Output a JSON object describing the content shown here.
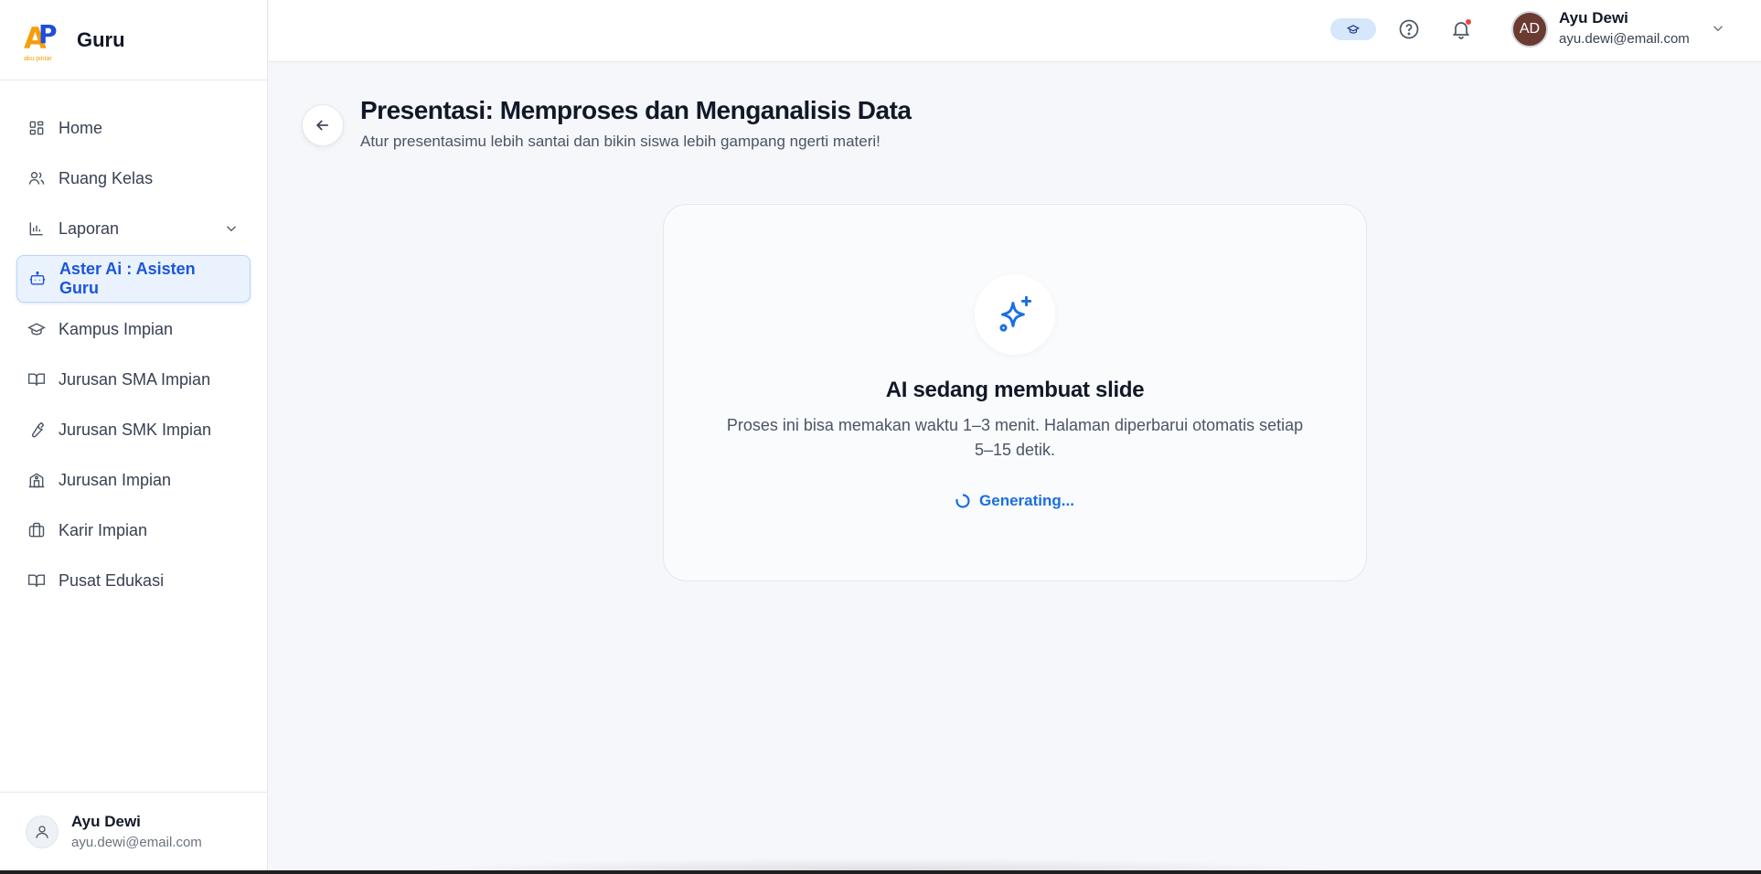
{
  "brand": {
    "logo_text": "AP",
    "logo_sub": "aku pintar",
    "name": "Guru"
  },
  "sidebar": {
    "items": [
      {
        "label": "Home",
        "icon": "home-grid-icon"
      },
      {
        "label": "Ruang Kelas",
        "icon": "users-icon"
      },
      {
        "label": "Laporan",
        "icon": "bar-chart-icon"
      },
      {
        "label": "Aster Ai : Asisten Guru",
        "icon": "robot-icon"
      },
      {
        "label": "Kampus Impian",
        "icon": "graduation-cap-icon"
      },
      {
        "label": "Jurusan SMA Impian",
        "icon": "book-open-icon"
      },
      {
        "label": "Jurusan SMK Impian",
        "icon": "wrench-icon"
      },
      {
        "label": "Jurusan Impian",
        "icon": "building-icon"
      },
      {
        "label": "Karir Impian",
        "icon": "briefcase-icon"
      },
      {
        "label": "Pusat Edukasi",
        "icon": "book-icon"
      }
    ],
    "active_index": 3,
    "user": {
      "name": "Ayu Dewi",
      "email": "ayu.dewi@email.com"
    }
  },
  "header": {
    "user": {
      "initials": "AD",
      "name": "Ayu Dewi",
      "email": "ayu.dewi@email.com"
    }
  },
  "main": {
    "title": "Presentasi: Memproses dan Menganalisis Data",
    "subtitle": "Atur presentasimu lebih santai dan bikin siswa lebih gampang ngerti materi!",
    "card": {
      "title": "AI sedang membuat slide",
      "description": "Proses ini bisa memakan waktu 1–3 menit. Halaman diperbarui otomatis setiap 5–15 detik.",
      "status": "Generating..."
    }
  },
  "colors": {
    "accent": "#1a6fe0",
    "active_bg": "#eaf2fd",
    "avatar_bg": "#6b3a31"
  }
}
